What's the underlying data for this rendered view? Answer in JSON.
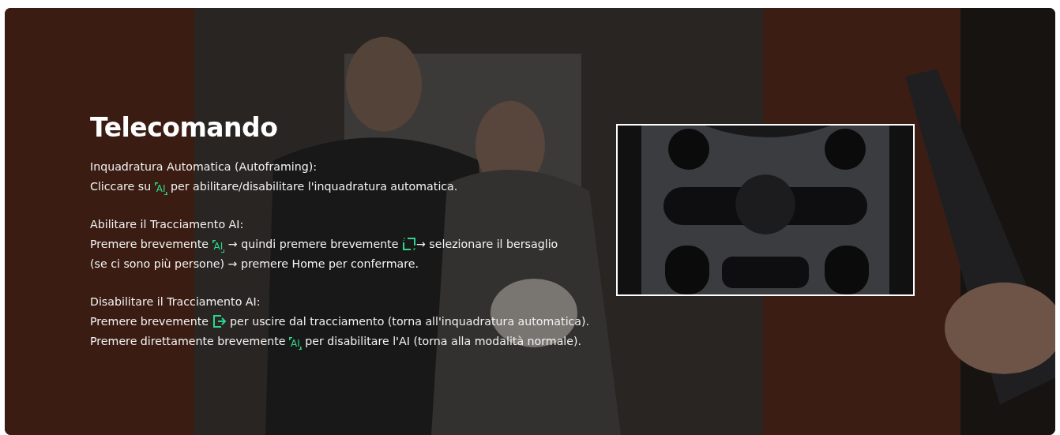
{
  "banner": {
    "title": "Telecomando",
    "sections": [
      {
        "heading": "Inquadratura Automatica (Autoframing):",
        "lines": [
          [
            {
              "kind": "text",
              "text": "Cliccare su "
            },
            {
              "kind": "ai-icon",
              "text": "AI"
            },
            {
              "kind": "text",
              "text": " per abilitare/disabilitare l'inquadratura automatica."
            }
          ]
        ]
      },
      {
        "heading": "Abilitare il Tracciamento AI:",
        "lines": [
          [
            {
              "kind": "text",
              "text": "Premere brevemente "
            },
            {
              "kind": "ai-icon",
              "text": "AI"
            },
            {
              "kind": "text",
              "text": " → quindi premere brevemente "
            },
            {
              "kind": "frame-icon"
            },
            {
              "kind": "text",
              "text": "→ selezionare il bersaglio"
            }
          ],
          [
            {
              "kind": "text",
              "text": "(se ci sono più persone) → premere Home per confermare."
            }
          ]
        ]
      },
      {
        "heading": "Disabilitare il Tracciamento AI:",
        "lines": [
          [
            {
              "kind": "text",
              "text": "Premere brevemente "
            },
            {
              "kind": "exit-icon"
            },
            {
              "kind": "text",
              "text": " per uscire dal tracciamento (torna all'inquadratura automatica)."
            }
          ],
          [
            {
              "kind": "text",
              "text": "Premere direttamente brevemente "
            },
            {
              "kind": "ai-icon",
              "text": "AI"
            },
            {
              "kind": "text",
              "text": " per disabilitare l'AI (torna alla modalità normale)."
            }
          ]
        ]
      }
    ]
  }
}
